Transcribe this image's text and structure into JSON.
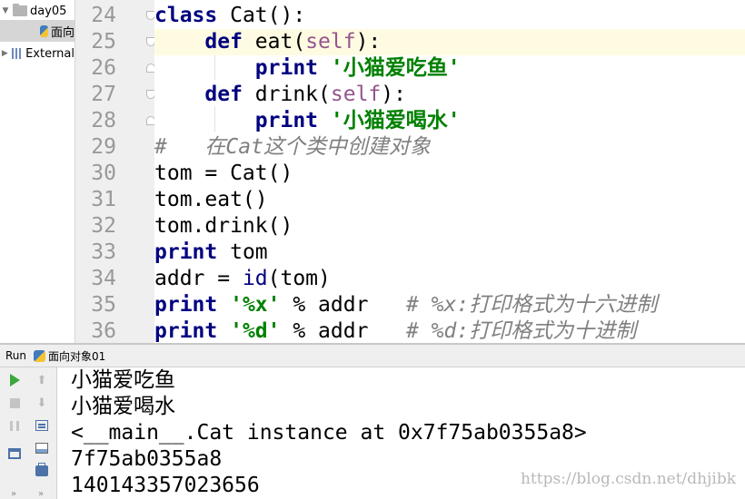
{
  "project_tree": {
    "items": [
      {
        "label": "day05",
        "kind": "folder"
      },
      {
        "label": "面向",
        "kind": "file"
      },
      {
        "label": "External",
        "kind": "library"
      }
    ]
  },
  "editor": {
    "line_numbers": [
      "24",
      "25",
      "26",
      "27",
      "28",
      "29",
      "30",
      "31",
      "32",
      "33",
      "34",
      "35",
      "36"
    ],
    "lines": {
      "l24": {
        "kw": "class",
        "rest": " Cat():"
      },
      "l25": {
        "kw": "def",
        "name": " eat(",
        "self": "self",
        "end": "):"
      },
      "l26": {
        "kw": "print",
        "str": "'小猫爱吃鱼'"
      },
      "l27": {
        "kw": "def",
        "name": " drink(",
        "self": "self",
        "end": "):"
      },
      "l28": {
        "kw": "print",
        "str": "'小猫爱喝水'"
      },
      "l29": {
        "comment": "#   在Cat这个类中创建对象"
      },
      "l30": {
        "text": "tom = Cat()"
      },
      "l31": {
        "text": "tom.eat()"
      },
      "l32": {
        "text": "tom.drink()"
      },
      "l33": {
        "kw": "print",
        "rest": " tom"
      },
      "l34": {
        "pre": "addr = ",
        "builtin": "id",
        "post": "(tom)"
      },
      "l35": {
        "kw": "print",
        "str": "'%x'",
        "mid": " % addr   ",
        "comment": "# %x:打印格式为十六进制"
      },
      "l36": {
        "kw": "print",
        "str": "'%d'",
        "mid": " % addr   ",
        "comment": "# %d:打印格式为十进制"
      }
    }
  },
  "run_panel": {
    "title": "Run",
    "tab_label": "面向对象01"
  },
  "console": {
    "lines": [
      "小猫爱吃鱼",
      "小猫爱喝水",
      "<__main__.Cat instance at 0x7f75ab0355a8>",
      "7f75ab0355a8",
      "140143357023656"
    ]
  },
  "watermark": "https://blog.csdn.net/dhjibk",
  "colors": {
    "keyword": "#000080",
    "string": "#008000",
    "self": "#94558d",
    "comment": "#808080",
    "current_line": "#fffbe2",
    "run_icon": "#3aa83a"
  }
}
